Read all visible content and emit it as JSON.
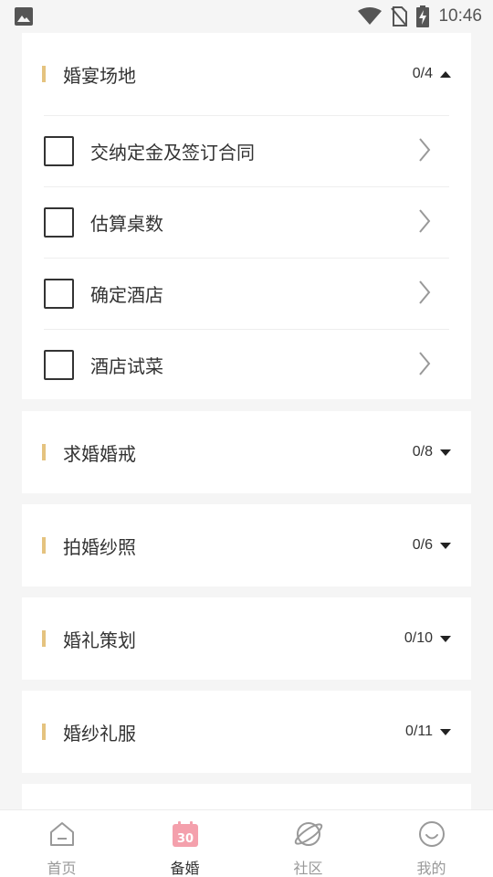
{
  "status_bar": {
    "time": "10:46",
    "icons": [
      "image-icon",
      "wifi-icon",
      "no-sim-icon",
      "battery-charging-icon"
    ]
  },
  "sections": [
    {
      "title": "婚宴场地",
      "progress": "0/4",
      "expanded": true,
      "tasks": [
        {
          "label": "交纳定金及签订合同",
          "checked": false
        },
        {
          "label": "估算桌数",
          "checked": false
        },
        {
          "label": "确定酒店",
          "checked": false
        },
        {
          "label": "酒店试菜",
          "checked": false
        }
      ]
    },
    {
      "title": "求婚婚戒",
      "progress": "0/8",
      "expanded": false
    },
    {
      "title": "拍婚纱照",
      "progress": "0/6",
      "expanded": false
    },
    {
      "title": "婚礼策划",
      "progress": "0/10",
      "expanded": false
    },
    {
      "title": "婚纱礼服",
      "progress": "0/11",
      "expanded": false
    }
  ],
  "bottom_nav": {
    "items": [
      {
        "label": "首页",
        "icon": "home-icon",
        "active": false
      },
      {
        "label": "备婚",
        "icon": "calendar-icon",
        "icon_text": "30",
        "active": true
      },
      {
        "label": "社区",
        "icon": "planet-icon",
        "active": false
      },
      {
        "label": "我的",
        "icon": "smile-icon",
        "active": false
      }
    ]
  },
  "colors": {
    "accent": "#e5c37f",
    "calendar_pink": "#f4a0ac",
    "background": "#f5f5f5",
    "text": "#333333",
    "muted": "#999999"
  }
}
